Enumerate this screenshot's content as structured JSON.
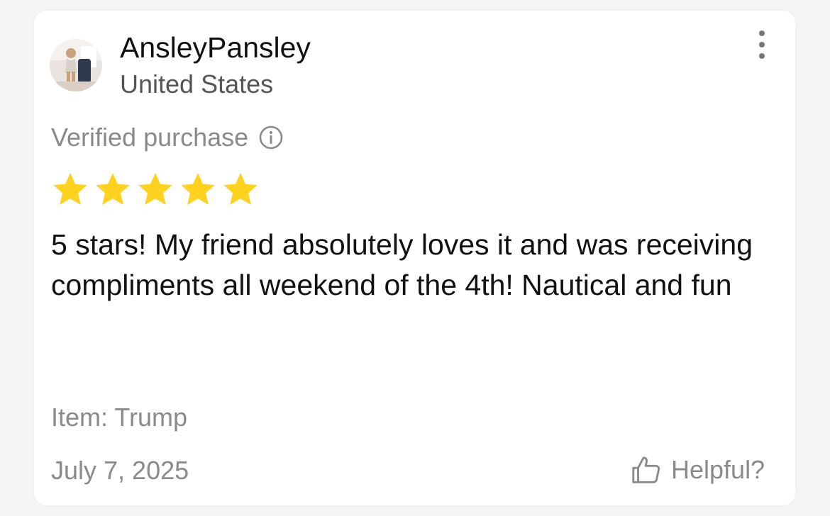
{
  "review": {
    "user": {
      "name": "AnsleyPansley",
      "country": "United States"
    },
    "verified_label": "Verified purchase",
    "rating": 5,
    "rating_max": 5,
    "text": "5 stars! My friend absolutely loves it and was receiving compliments all weekend of the 4th! Nautical and fun",
    "item_label": "Item: Trump",
    "date": "July 7, 2025",
    "helpful_label": "Helpful?"
  },
  "icons": {
    "menu": "more-vertical-icon",
    "info": "info-icon",
    "star": "star-icon",
    "helpful": "thumbs-up-icon"
  },
  "colors": {
    "star": "#FFD21F",
    "primary_text": "#111111",
    "secondary_text": "#8A8A8A"
  }
}
